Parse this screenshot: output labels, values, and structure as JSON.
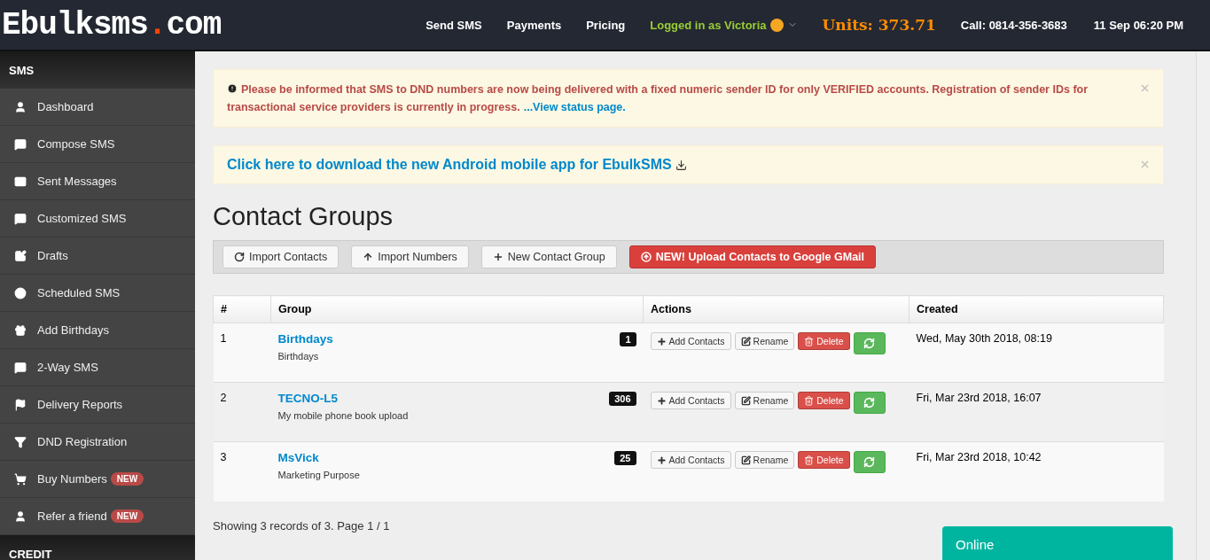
{
  "header": {
    "logo": {
      "name": "Ebulksms",
      "dot": ".",
      "domain": "com"
    },
    "nav": [
      "Send SMS",
      "Payments",
      "Pricing"
    ],
    "user": "Logged in as Victoria",
    "units": "Units: 373.71",
    "call": "Call: 0814-356-3683",
    "datetime": "11 Sep 06:20 PM"
  },
  "sidebar": {
    "sections": [
      {
        "title": "SMS",
        "items": [
          {
            "label": "Dashboard"
          },
          {
            "label": "Compose SMS"
          },
          {
            "label": "Sent Messages"
          },
          {
            "label": "Customized SMS"
          },
          {
            "label": "Drafts"
          },
          {
            "label": "Scheduled SMS"
          },
          {
            "label": "Add Birthdays"
          },
          {
            "label": "2-Way SMS"
          },
          {
            "label": "Delivery Reports"
          },
          {
            "label": "DND Registration"
          },
          {
            "label": "Buy Numbers",
            "badge": "NEW"
          },
          {
            "label": "Refer a friend",
            "badge": "NEW"
          }
        ]
      },
      {
        "title": "CREDIT"
      }
    ]
  },
  "alerts": [
    {
      "kind": "warning",
      "text": "Please be informed that SMS to DND numbers are now being delivered with a fixed numeric sender ID for only VERIFIED accounts. Registration of sender IDs for transactional service providers is currently in progress.",
      "link": "...View status page."
    },
    {
      "kind": "download",
      "text": "Click here to download the new Android mobile app for EbulkSMS"
    }
  ],
  "title": "Contact Groups",
  "toolbar": [
    {
      "label": "Import Contacts",
      "kind": "default"
    },
    {
      "label": "Import Numbers",
      "kind": "default"
    },
    {
      "label": "New Contact Group",
      "kind": "default"
    },
    {
      "label": "NEW! Upload Contacts to Google GMail",
      "kind": "danger"
    }
  ],
  "table": {
    "columns": [
      "#",
      "Group",
      "Actions",
      "Created"
    ],
    "rows": [
      {
        "number": "1",
        "name": "Birthdays",
        "description": "Birthdays",
        "count": "1",
        "actions": [
          "Add Contacts",
          "Rename",
          "Delete"
        ],
        "created": "Wed, May 30th 2018, 08:19"
      },
      {
        "number": "2",
        "name": "TECNO-L5",
        "description": "My mobile phone book upload",
        "count": "306",
        "actions": [
          "Add Contacts",
          "Rename",
          "Delete"
        ],
        "created": "Fri, Mar 23rd 2018, 16:07"
      },
      {
        "number": "3",
        "name": "MsVick",
        "description": "Marketing Purpose",
        "count": "25",
        "actions": [
          "Add Contacts",
          "Rename",
          "Delete"
        ],
        "created": "Fri, Mar 23rd 2018, 10:42"
      }
    ]
  },
  "footer": "Showing 3 records of 3. Page 1 / 1",
  "chat": {
    "label": "Online"
  }
}
